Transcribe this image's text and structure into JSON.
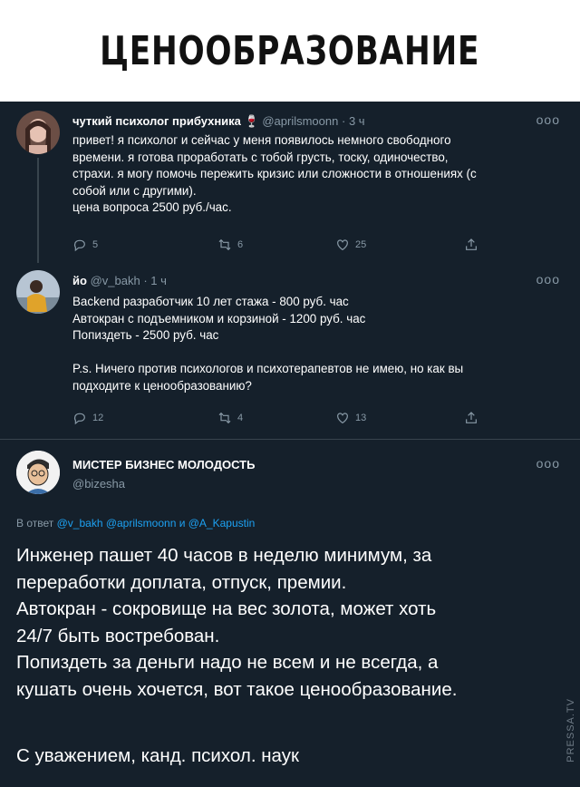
{
  "banner": {
    "title": "ЦЕНООБРАЗОВАНИЕ"
  },
  "tweets": [
    {
      "author": "чуткий психолог прибухника",
      "emoji": "🍷",
      "handle": "@aprilsmoonn",
      "time": "3 ч",
      "text": "привет! я психолог и сейчас у меня появилось немного свободного\nвремени. я готова проработать с тобой грусть, тоску, одиночество,\nстрахи. я могу помочь пережить кризис или сложности в отношениях (с\nсобой или с другими).\nцена вопроса 2500 руб./час.",
      "replies": "5",
      "retweets": "6",
      "likes": "25"
    },
    {
      "author": "йо",
      "handle": "@v_bakh",
      "time": "1 ч",
      "text": "Backend разработчик 10 лет стажа - 800 руб. час\nАвтокран с подъемником и корзиной - 1200 руб. час\nПопиздеть - 2500 руб. час\n\nP.s. Ничего против психологов и психотерапевтов не имею, но как вы\nподходите к ценообразованию?",
      "replies": "12",
      "retweets": "4",
      "likes": "13"
    }
  ],
  "main_tweet": {
    "author": "МИСТЕР БИЗНЕС МОЛОДОСТЬ",
    "handle": "@bizesha",
    "reply_prefix": "В ответ",
    "reply_mentions": "@v_bakh @aprilsmoonn и @A_Kapustin",
    "text": "Инженер пашет 40 часов в неделю минимум, за\nпереработки доплата, отпуск, премии.\nАвтокран - сокровище на вес золота, может хоть\n24/7 быть востребован.\nПопиздеть за деньги надо не всем и не всегда, а\nкушать очень хочется, вот такое ценообразование.",
    "signature": "С уважением, канд. психол. наук"
  },
  "more_glyph": "ooo",
  "watermark": "PRESSA.TV",
  "colors": {
    "background": "#15202b",
    "secondary": "#8899a6",
    "link": "#1da1f2",
    "divider": "#38444d"
  }
}
